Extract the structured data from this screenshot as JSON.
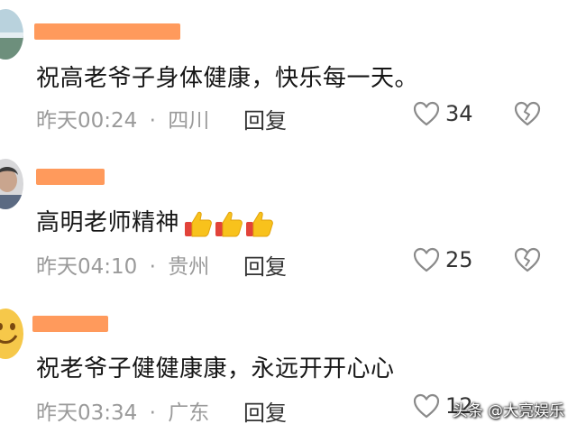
{
  "comments": [
    {
      "text": "祝高老爷子身体健康，快乐每一天。",
      "time": "昨天00:24",
      "location": "四川",
      "reply": "回复",
      "likes": "34",
      "emoji_count": 0
    },
    {
      "text": "高明老师精神",
      "time": "昨天04:10",
      "location": "贵州",
      "reply": "回复",
      "likes": "25",
      "emoji_count": 3
    },
    {
      "text": "祝老爷子健健康康，永远开开心心",
      "time": "昨天03:34",
      "location": "广东",
      "reply": "回复",
      "likes": "12",
      "emoji_count": 0
    }
  ],
  "separator": "·",
  "watermark": "头条 @大亮娱乐",
  "colors": {
    "name_redaction": "#ff9a5c",
    "meta_text": "#9a9a9a",
    "body_text": "#161616",
    "icon_stroke": "#8a8a8a"
  },
  "icons": {
    "like": "heart-outline-icon",
    "dislike": "broken-heart-icon",
    "emoji": "thumbs-up-emoji-icon"
  }
}
